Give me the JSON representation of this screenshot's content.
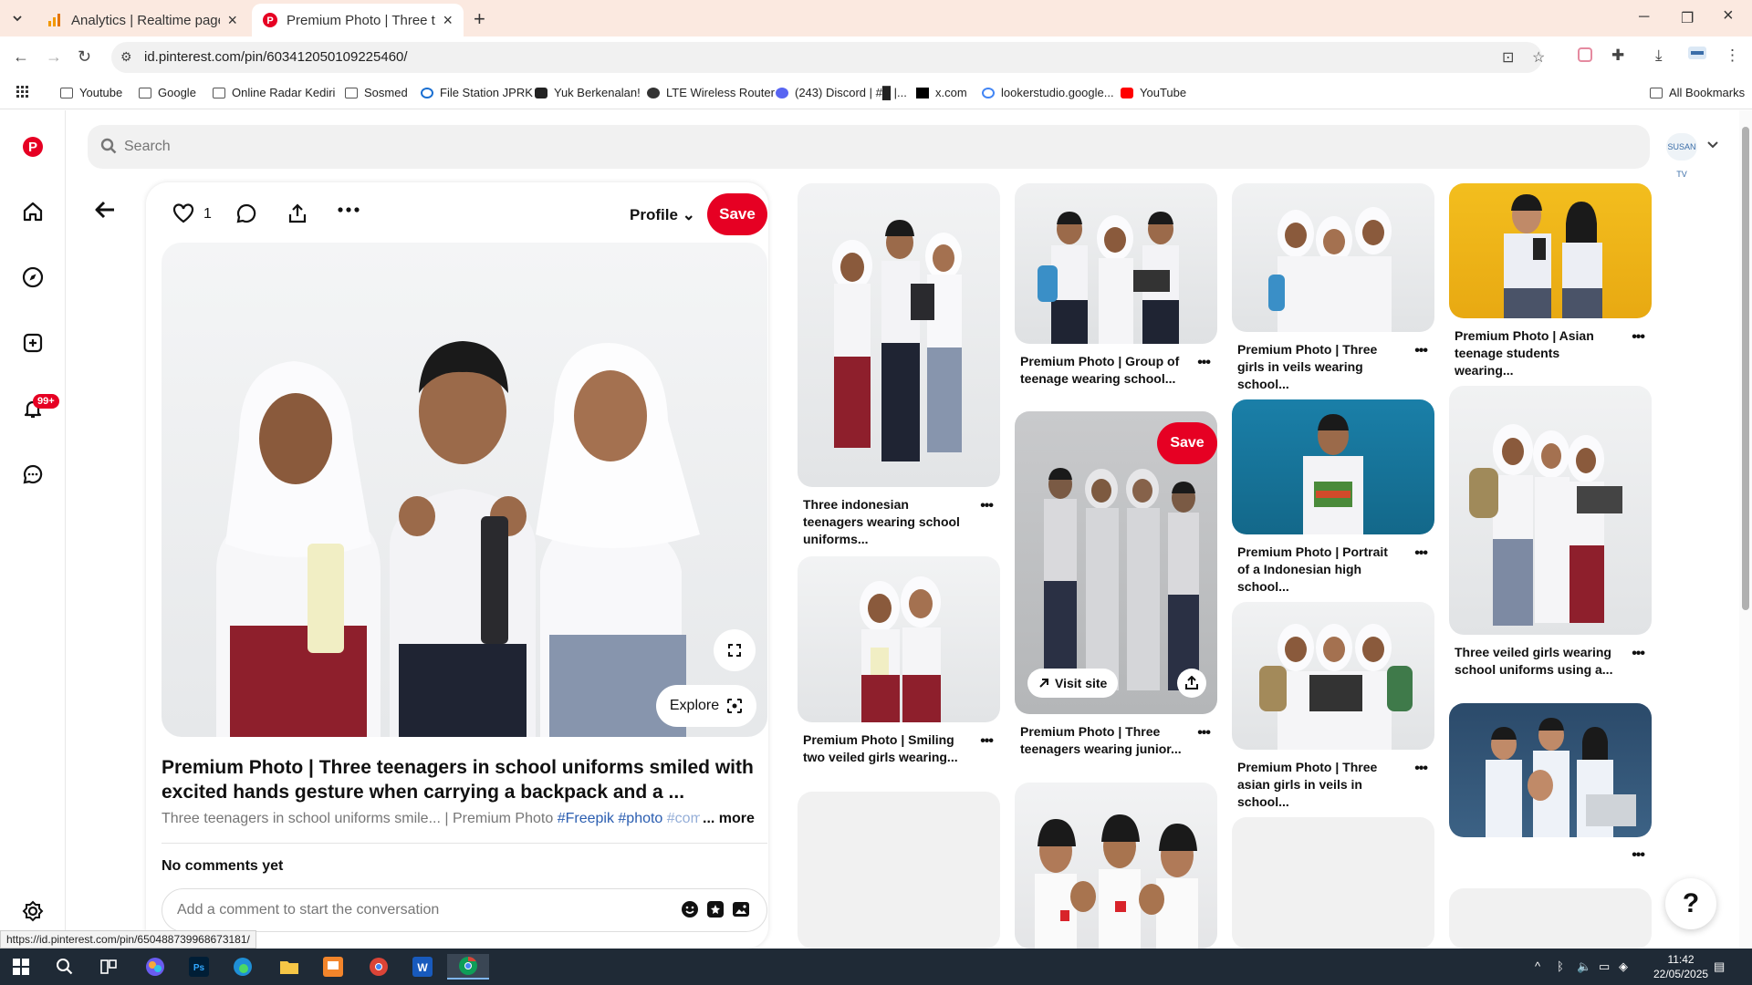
{
  "browser": {
    "tabs": [
      {
        "label": "Analytics | Realtime pages",
        "active": false
      },
      {
        "label": "Premium Photo | Three teenagers in school uniforms",
        "active": true
      }
    ],
    "url": "id.pinterest.com/pin/603412050109225460/",
    "bookmarks": [
      "Youtube",
      "Google",
      "Online Radar Kediri",
      "Sosmed",
      "File Station JPRK",
      "Yuk Berkenalan!",
      "LTE Wireless Router",
      "(243) Discord | #█ |...",
      "x.com",
      "lookerstudio.google...",
      "YouTube"
    ],
    "all_bookmarks": "All Bookmarks",
    "status_url": "https://id.pinterest.com/pin/650488739968673181/"
  },
  "sidebar": {
    "notification_badge": "99+",
    "icons": [
      "pinterest-logo-icon",
      "home-icon",
      "explore-icon",
      "create-icon",
      "notifications-icon",
      "messages-icon",
      "settings-icon"
    ]
  },
  "search": {
    "placeholder": "Search"
  },
  "account": {
    "label": "SUSAN TV"
  },
  "pin": {
    "like_count": "1",
    "profile_label": "Profile",
    "save_label": "Save",
    "explore_label": "Explore",
    "title": "Premium Photo | Three teenagers in school uniforms smiled with excited hands gesture when carrying a backpack and a ...",
    "desc_text": "Three teenagers in school uniforms smile... | Premium Photo",
    "desc_tags": [
      "#Freepik",
      "#photo",
      "#com"
    ],
    "more_label": "... more",
    "no_comments": "No comments yet",
    "comment_placeholder": "Add a comment to start the conversation"
  },
  "grid": {
    "col1": [
      {
        "caption": "Three indonesian teenagers wearing school uniforms..."
      },
      {
        "caption": "Premium Photo | Smiling two veiled girls wearing..."
      }
    ],
    "col2": [
      {
        "caption": "Premium Photo | Group of teenage wearing school..."
      },
      {
        "caption": "Premium Photo | Three teenagers wearing junior...",
        "save_label": "Save",
        "visit_label": "Visit site"
      }
    ],
    "col3": [
      {
        "caption": "Premium Photo | Three girls in veils wearing school..."
      },
      {
        "caption": "Premium Photo | Portrait of a Indonesian high school..."
      },
      {
        "caption": "Premium Photo | Three asian girls in veils in school..."
      }
    ],
    "col4": [
      {
        "caption": "Premium Photo | Asian teenage students wearing..."
      },
      {
        "caption": "Three veiled girls wearing school uniforms using a..."
      }
    ]
  },
  "help": {
    "label": "?"
  },
  "taskbar": {
    "time": "11:42",
    "date": "22/05/2025"
  },
  "colors": {
    "brand": "#e60023",
    "tab_bar": "#fbe9e0",
    "taskbar": "#1f2a36"
  }
}
